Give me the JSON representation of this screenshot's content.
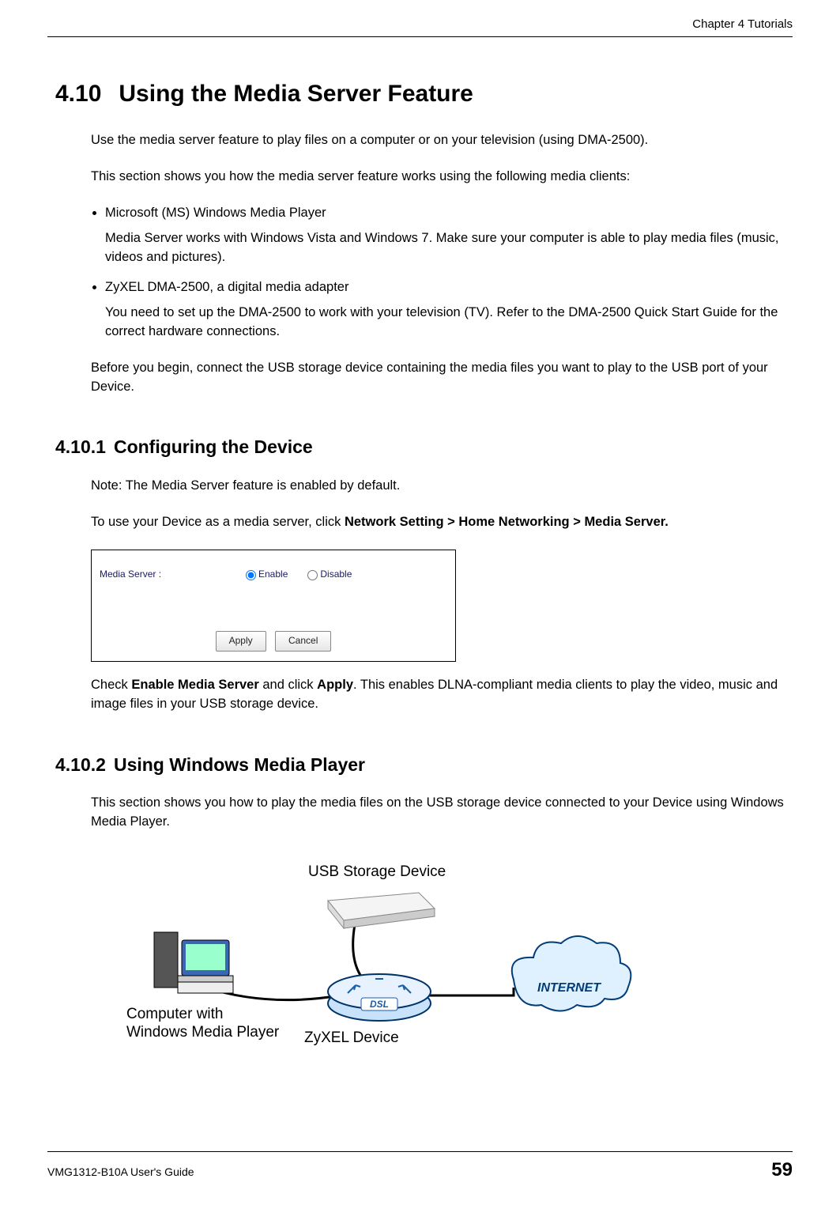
{
  "header": {
    "chapter": "Chapter 4 Tutorials"
  },
  "section410": {
    "num": "4.10",
    "title": "Using the Media Server Feature",
    "intro1": "Use the media server feature to play files on a computer or on your television (using DMA-2500).",
    "intro2": "This section shows you how the media server feature works using the following media clients:",
    "bullet1": "Microsoft (MS) Windows Media Player",
    "bullet1_desc": "Media Server works with Windows Vista and Windows 7. Make sure your computer is able to play media files (music, videos and pictures).",
    "bullet2": "ZyXEL DMA-2500, a digital media adapter",
    "bullet2_desc": "You need to set up the DMA-2500 to work with your television (TV). Refer to the DMA-2500 Quick Start Guide for the correct hardware connections.",
    "before": "Before you begin, connect the USB storage device containing the media files you want to play to the USB port of your Device."
  },
  "section4101": {
    "num": "4.10.1",
    "title": "Configuring the Device",
    "note": "Note: The Media Server feature is enabled by default.",
    "instruct_pre": "To use your Device as a media server, click ",
    "instruct_bold": "Network Setting > Home Networking > Media Server.",
    "ui": {
      "label": "Media Server :",
      "enable": "Enable",
      "disable": "Disable",
      "apply": "Apply",
      "cancel": "Cancel"
    },
    "after_pre": "Check ",
    "after_b1": "Enable Media Server",
    "after_mid": " and click ",
    "after_b2": "Apply",
    "after_post": ". This enables DLNA-compliant media clients to play the video, music and image files in your USB storage device."
  },
  "section4102": {
    "num": "4.10.2",
    "title": "Using Windows Media Player",
    "intro": "This section shows you how to play the media files on the USB storage device connected to your Device using Windows Media Player."
  },
  "diagram": {
    "usb": "USB Storage Device",
    "computer_l1": "Computer with",
    "computer_l2": "Windows Media Player",
    "zyxel": "ZyXEL Device",
    "internet": "INTERNET",
    "dsl": "DSL"
  },
  "footer": {
    "guide": "VMG1312-B10A User's Guide",
    "page": "59"
  }
}
